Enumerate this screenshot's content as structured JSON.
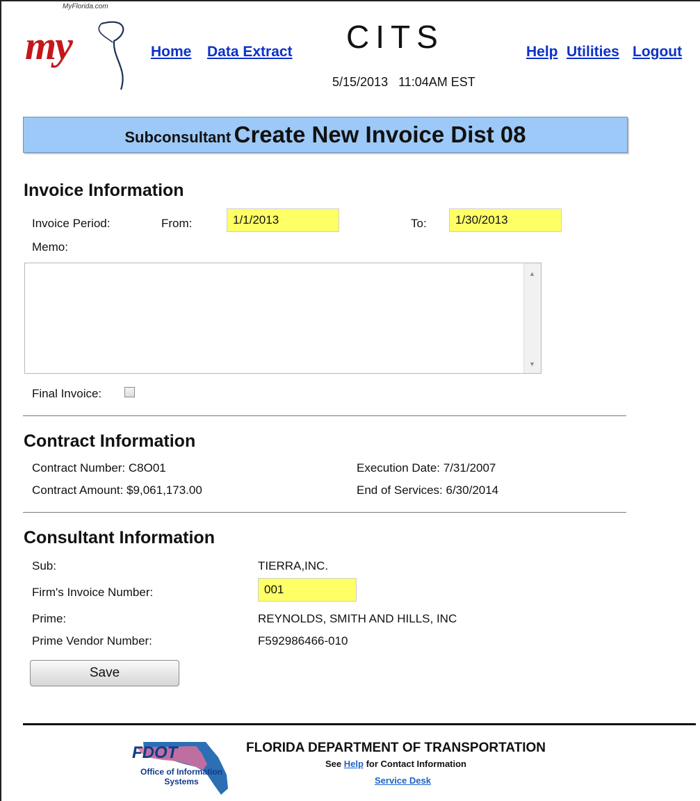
{
  "header": {
    "logo_caption": "MyFlorida.com",
    "logo_word": "my",
    "app_title": "CITS",
    "datetime": "5/15/2013   11:04AM EST",
    "nav_left": [
      "Home",
      "Data Extract"
    ],
    "nav_right": [
      "Help",
      "Utilities",
      "Logout"
    ]
  },
  "banner": {
    "prefix": "Subconsultant",
    "title": "Create New Invoice Dist 08"
  },
  "invoice": {
    "heading": "Invoice Information",
    "period_label": "Invoice Period:",
    "from_label": "From:",
    "from_value": "1/1/2013",
    "to_label": "To:",
    "to_value": "1/30/2013",
    "memo_label": "Memo:",
    "memo_value": "",
    "final_label": "Final Invoice:",
    "final_checked": false
  },
  "contract": {
    "heading": "Contract Information",
    "number": "Contract Number: C8O01",
    "amount": "Contract Amount: $9,061,173.00",
    "execution_date": "Execution Date: 7/31/2007",
    "end_of_services": "End of Services: 6/30/2014"
  },
  "consultant": {
    "heading": "Consultant Information",
    "sub_label": "Sub:",
    "sub_value": "TIERRA,INC.",
    "invoice_number_label": "Firm's Invoice Number:",
    "invoice_number_value": "001",
    "prime_label": "Prime:",
    "prime_value": "REYNOLDS, SMITH AND HILLS, INC",
    "vendor_label": "Prime Vendor Number:",
    "vendor_value": "F592986466-010"
  },
  "actions": {
    "save_label": "Save"
  },
  "footer": {
    "logo_word": "FDOT",
    "logo_office": "Office of Information Systems",
    "title": "FLORIDA DEPARTMENT OF TRANSPORTATION",
    "help_prefix": "See",
    "help_link": "Help",
    "help_suffix": "for Contact Information",
    "service_desk": "Service Desk"
  },
  "colors": {
    "banner": "#9cc9f7",
    "required_field": "#ffff66",
    "link": "#0b31c8",
    "logo_red": "#c4161c"
  }
}
